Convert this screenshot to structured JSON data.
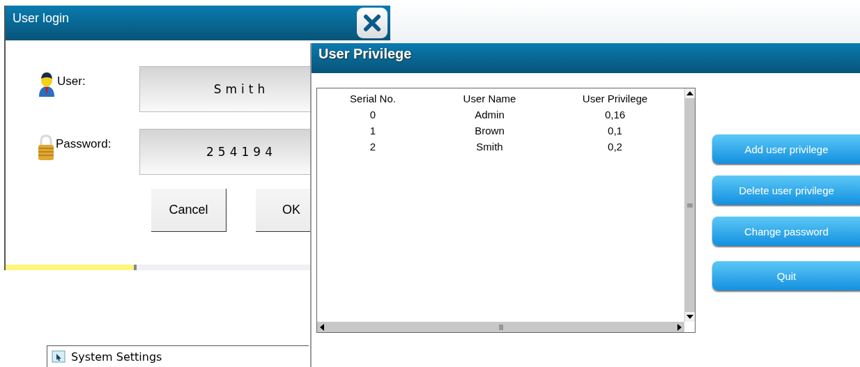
{
  "login_window": {
    "title": "User login",
    "fields": [
      {
        "kind": "user",
        "label": "User:",
        "value": "Smith"
      },
      {
        "kind": "password",
        "label": "Password:",
        "value": "254194"
      }
    ],
    "buttons": [
      "Cancel",
      "OK"
    ]
  },
  "privilege_window": {
    "title": "User Privilege",
    "table": {
      "columns": [
        "Serial No.",
        "User Name",
        "User Privilege"
      ],
      "rows": [
        [
          "0",
          "Admin",
          "0,16"
        ],
        [
          "1",
          "Brown",
          "0,1"
        ],
        [
          "2",
          "Smith",
          "0,2"
        ]
      ]
    },
    "buttons": [
      "Add user privilege",
      "Delete user privilege",
      "Change password",
      "Quit"
    ]
  },
  "taskbar_item": {
    "label": "System Settings"
  }
}
